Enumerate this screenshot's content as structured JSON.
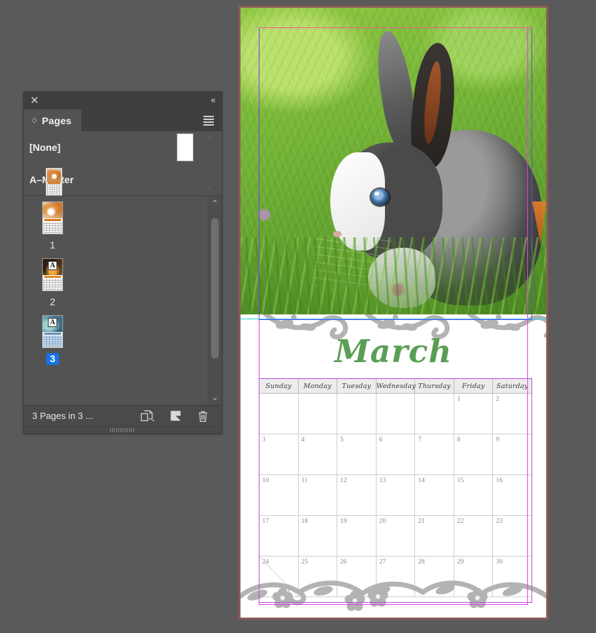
{
  "app": {
    "window_background": "#5a5a5a"
  },
  "pages_panel": {
    "titlebar": {
      "close_icon": "close-icon",
      "close_glyph": "✕",
      "collapse_icon": "collapse-icon",
      "collapse_glyph": "«"
    },
    "tab": {
      "diamond_glyph": "◇",
      "label": "Pages",
      "menu_icon": "panel-menu-icon"
    },
    "masters": {
      "scroll_up_glyph": "⌃",
      "scroll_down_glyph": "⌄",
      "items": [
        {
          "name": "[None]",
          "thumb_kind": "blank"
        },
        {
          "name": "A–Master",
          "thumb_kind": "photo"
        }
      ]
    },
    "pages": {
      "scroll_up_glyph": "⌃",
      "scroll_down_glyph": "⌄",
      "items": [
        {
          "number": "1",
          "master_badge": "",
          "selected": false
        },
        {
          "number": "2",
          "master_badge": "A",
          "selected": false
        },
        {
          "number": "3",
          "master_badge": "A",
          "selected": true
        }
      ]
    },
    "footer": {
      "count_label": "3 Pages in 3 ...",
      "icons": [
        {
          "name": "new-page-icon"
        },
        {
          "name": "create-spread-icon"
        },
        {
          "name": "delete-page-icon"
        }
      ]
    },
    "selection_color": "#1473e6"
  },
  "document": {
    "hero": {
      "alt": "grey and white rabbit sitting in green grass"
    },
    "month_title": "March",
    "calendar": {
      "day_headers": [
        "Sunday",
        "Monday",
        "Tuesday",
        "Wednesday",
        "Thursday",
        "Friday",
        "Saturday"
      ],
      "weeks": [
        [
          "",
          "",
          "",
          "",
          "",
          "1",
          "2"
        ],
        [
          "3",
          "4",
          "5",
          "6",
          "7",
          "8",
          "9"
        ],
        [
          "10",
          "11",
          "12",
          "13",
          "14",
          "15",
          "16"
        ],
        [
          "17",
          "18",
          "19",
          "20",
          "21",
          "22",
          "23"
        ],
        [
          "24|31",
          "25",
          "26",
          "27",
          "28",
          "29",
          "30"
        ]
      ]
    },
    "guides": {
      "margin_color": "#e83fe8",
      "frame_color": "#7b3fe8",
      "photo_edge_color": "#22d3e8",
      "bleed_color": "#8d5a57"
    },
    "title_color": "#5a9e55"
  }
}
